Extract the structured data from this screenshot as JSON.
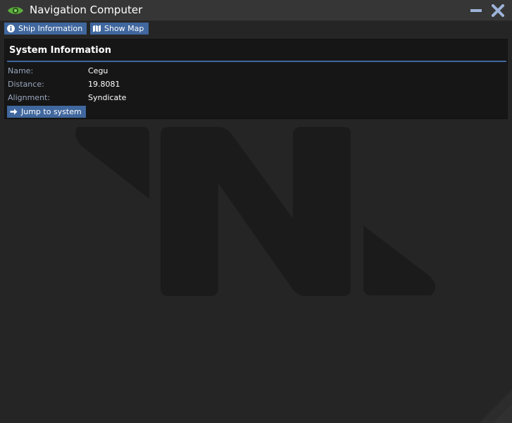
{
  "window": {
    "title": "Navigation Computer",
    "icon": "eye-icon",
    "controls": [
      "minimize-icon",
      "close-icon"
    ]
  },
  "toolbar": {
    "ship_info_label": "Ship Information",
    "ship_info_icon": "info-circle-icon",
    "show_map_label": "Show Map",
    "show_map_icon": "map-icon"
  },
  "system_info": {
    "heading": "System Information",
    "fields": [
      {
        "label": "Name:",
        "value": "Cegu"
      },
      {
        "label": "Distance:",
        "value": "19.8081"
      },
      {
        "label": "Alignment:",
        "value": "Syndicate"
      }
    ],
    "jump_label": "Jump to system",
    "jump_icon": "arrow-right-icon"
  },
  "background": {
    "watermark": "nanotrasen-logo"
  },
  "colors": {
    "accent": "#40679e",
    "label": "#98a6bd",
    "eye": "#5cae3d",
    "window_bg": "#252525",
    "panel_bg": "#161616"
  }
}
